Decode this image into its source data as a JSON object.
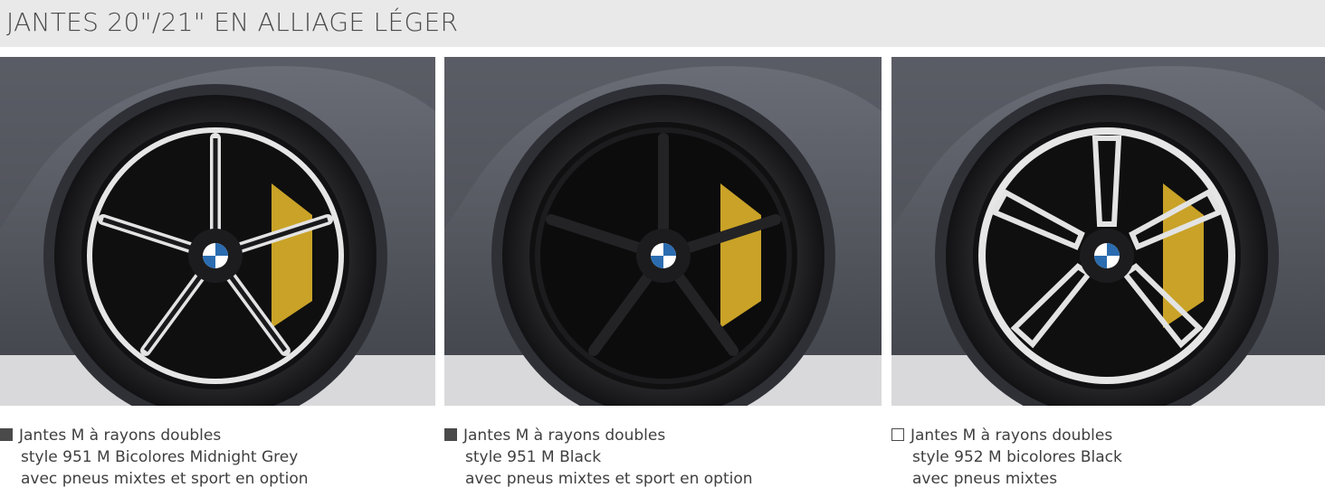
{
  "header": {
    "title": "JANTES 20\"/21\" EN ALLIAGE LÉGER"
  },
  "options": [
    {
      "marker": "filled",
      "line1": "Jantes M à rayons doubles",
      "line2": "style 951 M Bicolores Midnight Grey",
      "line3": "avec pneus mixtes et sport en option"
    },
    {
      "marker": "filled",
      "line1": "Jantes M à rayons doubles",
      "line2": "style 951 M Black",
      "line3": "avec pneus mixtes et sport en option"
    },
    {
      "marker": "empty",
      "line1": "Jantes M à rayons doubles",
      "line2": "style 952 M bicolores Black",
      "line3": "avec pneus mixtes"
    }
  ],
  "colors": {
    "header_bg": "#e9e9e9",
    "body_paint": "#5a5d66",
    "caliper": "#c9a227",
    "tire": "#1b1b1d",
    "rim_black": "#141416",
    "rim_polished": "#e6e6e6"
  }
}
